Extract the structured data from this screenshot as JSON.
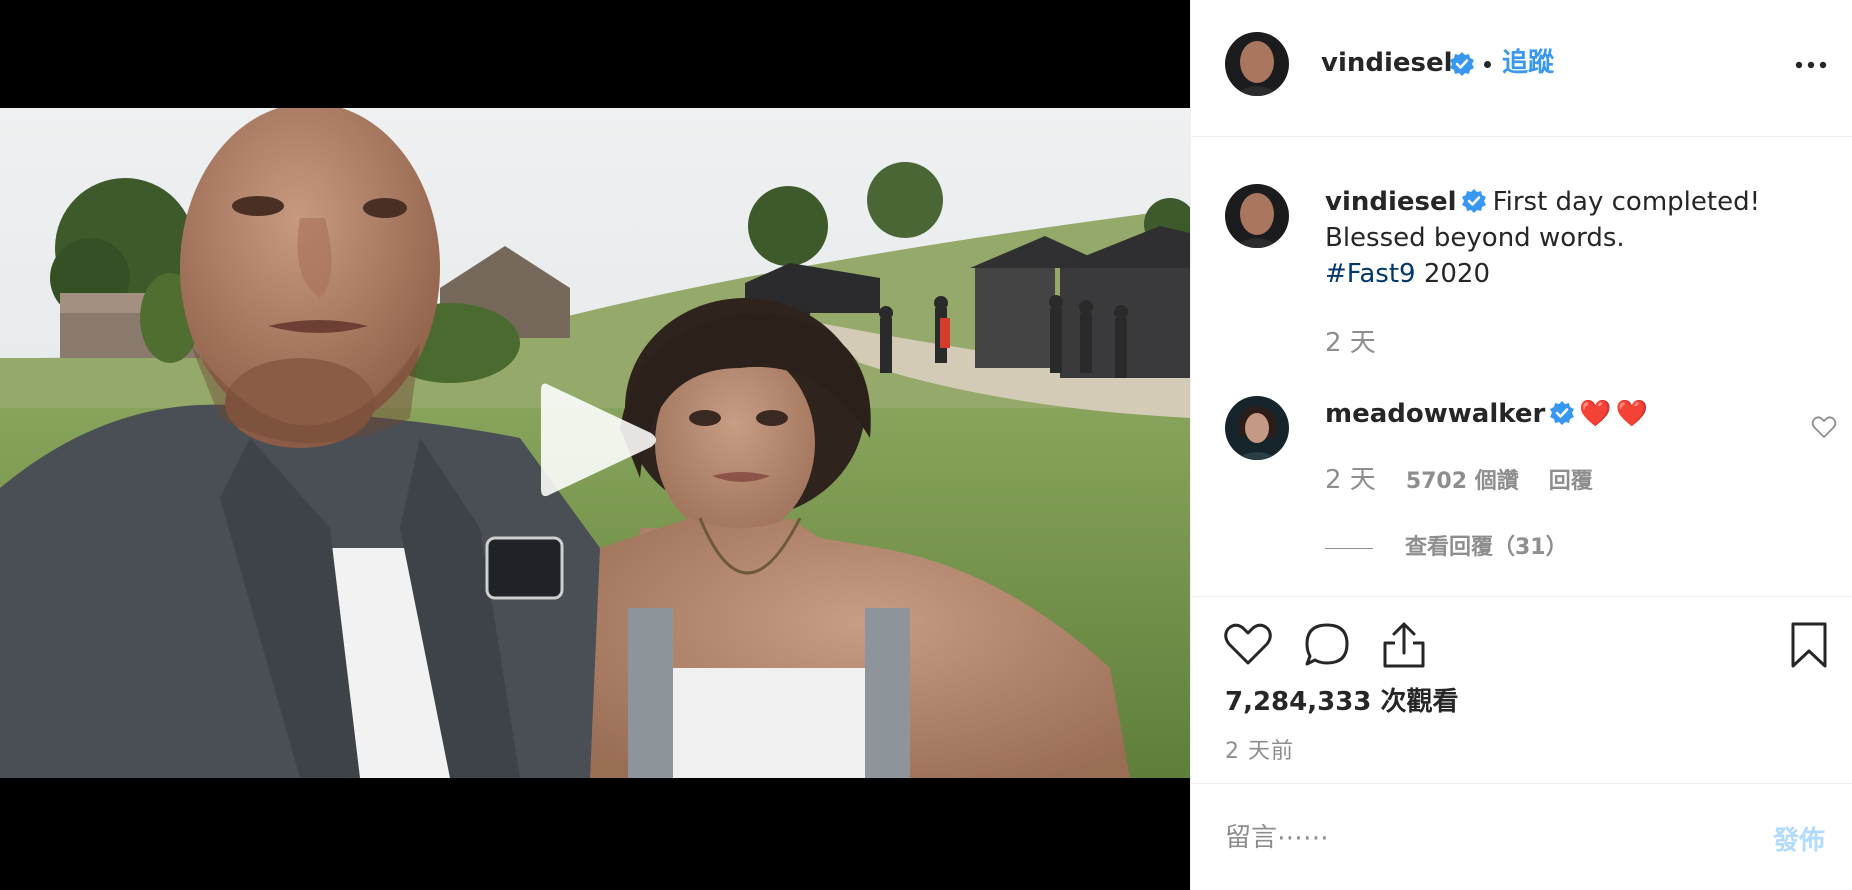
{
  "post": {
    "username": "vindiesel",
    "follow_label": "追蹤",
    "caption": {
      "username": "vindiesel",
      "text_line1": "First day completed!",
      "text_line2": "Blessed beyond words.",
      "hashtag": "#Fast9",
      "text_after_hashtag": " 2020",
      "time": "2 天"
    },
    "comment": {
      "username": "meadowwalker",
      "emoji": "❤️❤️",
      "time": "2 天",
      "likes": "5702 個讚",
      "reply_label": "回覆",
      "view_replies": "查看回覆（31）"
    },
    "views": "7,284,333 次觀看",
    "posted_ago": "2 天前",
    "composer": {
      "placeholder": "留言⋯⋯",
      "post_label": "發佈"
    }
  },
  "colors": {
    "verified_blue": "#3897f0",
    "link_blue": "#3897f0",
    "hashtag_navy": "#00376b",
    "muted_gray": "#8e8e8e",
    "post_disabled": "#b3dbff"
  },
  "icons": {
    "verified": "verified-badge-icon",
    "more": "more-options-icon",
    "like": "heart-icon",
    "comment": "comment-bubble-icon",
    "share": "share-icon",
    "save": "bookmark-icon",
    "play": "play-icon"
  }
}
